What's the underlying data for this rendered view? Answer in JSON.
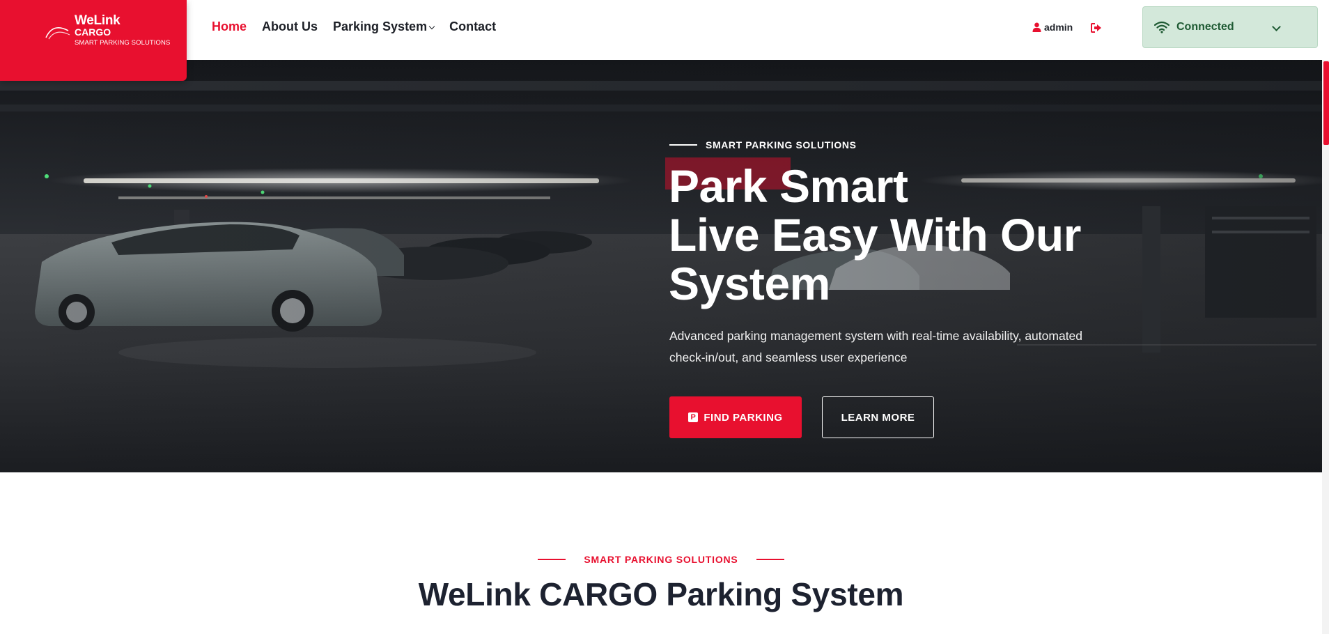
{
  "logo": {
    "brand": "WeLink",
    "sub": "CARGO",
    "tagline": "SMART PARKING SOLUTIONS"
  },
  "nav": {
    "items": [
      {
        "label": "Home",
        "active": true
      },
      {
        "label": "About Us",
        "active": false
      },
      {
        "label": "Parking System",
        "active": false,
        "dropdown": true
      },
      {
        "label": "Contact",
        "active": false
      }
    ]
  },
  "user": {
    "name": "admin"
  },
  "connection": {
    "status": "Connected",
    "color": "#1e5a33",
    "background": "#d3e8da"
  },
  "hero": {
    "tagline": "SMART PARKING SOLUTIONS",
    "title_line1": "Park Smart",
    "title_line2": "Live Easy With Our",
    "title_line3": "System",
    "description": "Advanced parking management system with real-time availability, automated check-in/out, and seamless user experience",
    "primary_button": "FIND PARKING",
    "primary_button_icon": "P",
    "secondary_button": "LEARN MORE"
  },
  "section": {
    "tagline": "SMART PARKING SOLUTIONS",
    "title": "WeLink CARGO Parking System"
  },
  "colors": {
    "accent": "#e8102f",
    "dark_text": "#1d2230"
  }
}
